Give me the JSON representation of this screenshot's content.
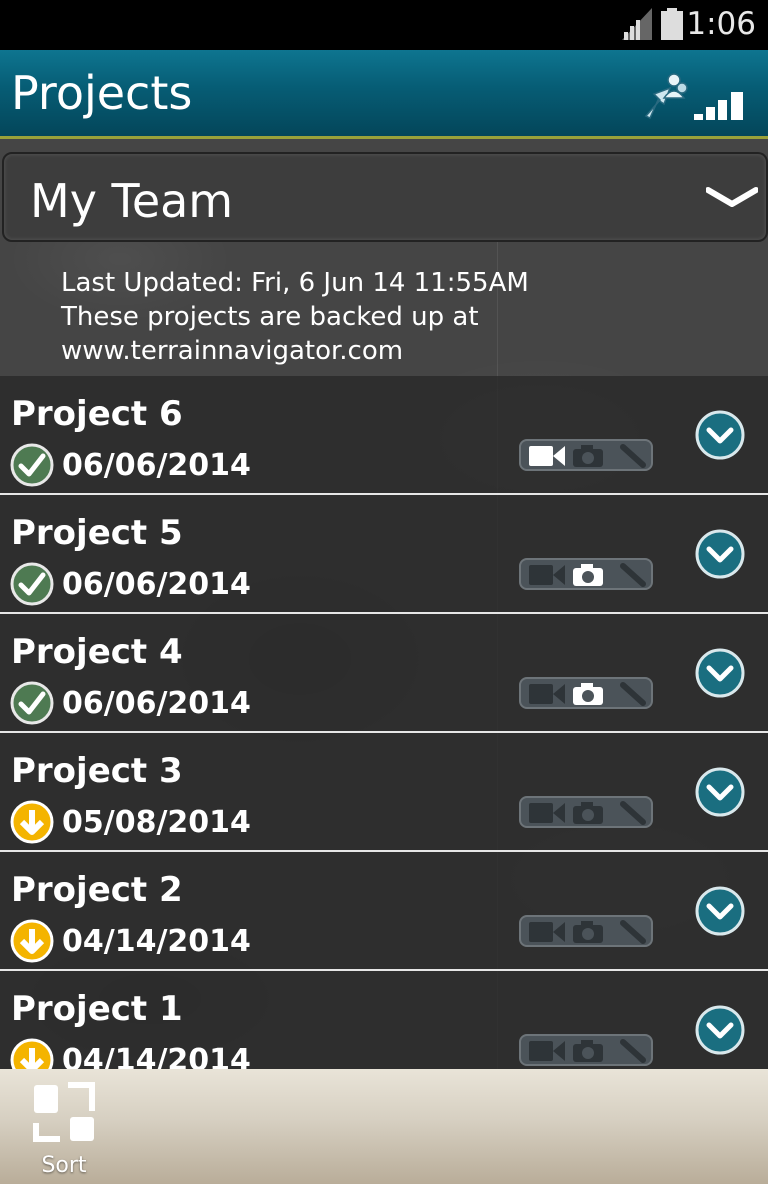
{
  "status_bar": {
    "time": "1:06"
  },
  "header": {
    "title": "Projects",
    "team_icon": "team-sync-icon",
    "connection_icon": "signal-strength-icon"
  },
  "dropdown": {
    "selected": "My Team",
    "icon": "chevron-down-icon"
  },
  "info": {
    "last_updated": "Last Updated: Fri, 6 Jun 14 11:55AM",
    "backup_line1": "These projects are backed up at",
    "backup_line2": "www.terrainnavigator.com"
  },
  "projects": [
    {
      "name": "Project 6",
      "date": "06/06/2014",
      "status": "synced",
      "active_media": "video"
    },
    {
      "name": "Project 5",
      "date": "06/06/2014",
      "status": "synced",
      "active_media": "photo"
    },
    {
      "name": "Project 4",
      "date": "06/06/2014",
      "status": "synced",
      "active_media": "photo"
    },
    {
      "name": "Project 3",
      "date": "05/08/2014",
      "status": "download",
      "active_media": "none"
    },
    {
      "name": "Project 2",
      "date": "04/14/2014",
      "status": "download",
      "active_media": "none"
    },
    {
      "name": "Project 1",
      "date": "04/14/2014",
      "status": "download",
      "active_media": "none"
    }
  ],
  "colors": {
    "synced": "#4e7a52",
    "download": "#f4b400",
    "accent": "#0b6b85",
    "expand": "#1a6e80"
  },
  "bottom_bar": {
    "sort_label": "Sort"
  }
}
